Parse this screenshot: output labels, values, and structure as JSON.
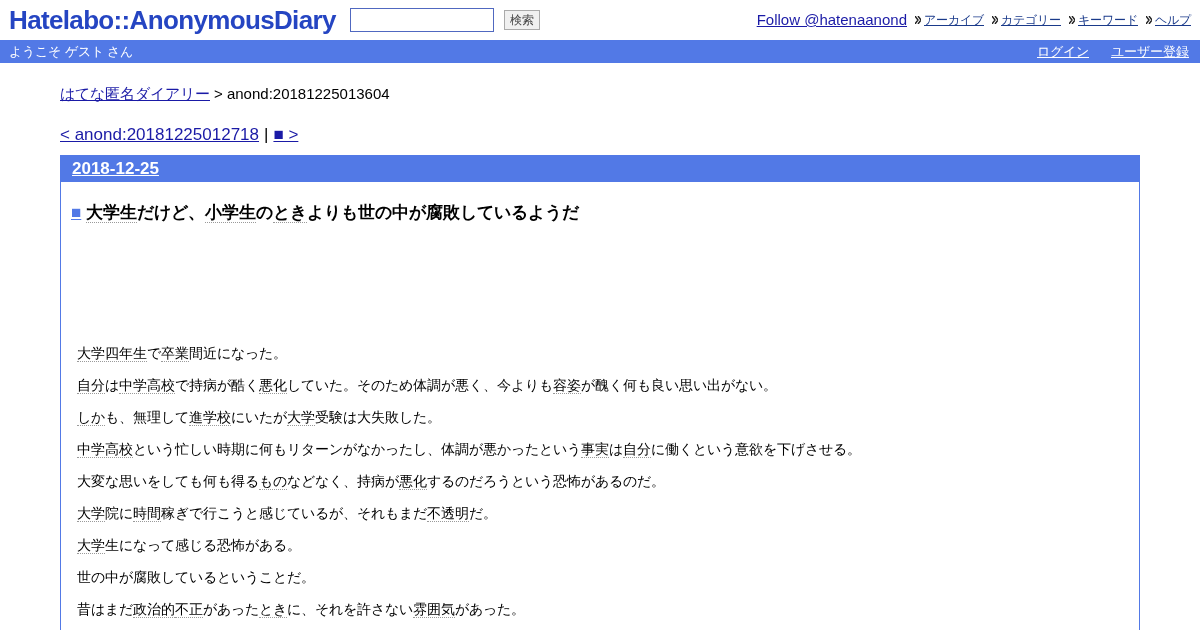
{
  "header": {
    "logo": "Hatelabo::AnonymousDiary",
    "search": {
      "button": "検索"
    },
    "follow": "Follow @hatenaanond",
    "nav": [
      "アーカイブ",
      "カテゴリー",
      "キーワード",
      "ヘルプ"
    ]
  },
  "bar": {
    "welcome": "ようこそ ゲスト さん",
    "links": [
      "ログイン",
      "ユーザー登録"
    ]
  },
  "breadcrumb": {
    "link": "はてな匿名ダイアリー",
    "current": "> anond:20181225013604"
  },
  "pager": {
    "prev": "< anond:20181225012718",
    "separator": "|",
    "next": "■ >"
  },
  "day": {
    "date": "2018-12-25",
    "title_mark": "■",
    "title": [
      {
        "text": "大学生",
        "keyword": true
      },
      {
        "text": "だけど、",
        "keyword": false
      },
      {
        "text": "小学生",
        "keyword": true
      },
      {
        "text": "の",
        "keyword": false
      },
      {
        "text": "とき",
        "keyword": true
      },
      {
        "text": "よりも世の中が腐敗しているようだ",
        "keyword": false
      }
    ],
    "paragraphs": [
      [
        {
          "text": "大学四年生",
          "keyword": true
        },
        {
          "text": "で",
          "keyword": false
        },
        {
          "text": "卒業",
          "keyword": true
        },
        {
          "text": "間近になった。",
          "keyword": false
        }
      ],
      [
        {
          "text": "自分",
          "keyword": true
        },
        {
          "text": "は",
          "keyword": false
        },
        {
          "text": "中学高校",
          "keyword": true
        },
        {
          "text": "で持病が酷く",
          "keyword": false
        },
        {
          "text": "悪化",
          "keyword": true
        },
        {
          "text": "していた。そのため体調が悪く、今よりも",
          "keyword": false
        },
        {
          "text": "容姿",
          "keyword": true
        },
        {
          "text": "が醜く何も良い思い出がない。",
          "keyword": false
        }
      ],
      [
        {
          "text": "しか",
          "keyword": true
        },
        {
          "text": "も、無理して",
          "keyword": false
        },
        {
          "text": "進学校",
          "keyword": true
        },
        {
          "text": "にいたが",
          "keyword": false
        },
        {
          "text": "大学",
          "keyword": true
        },
        {
          "text": "受験は大失敗した。",
          "keyword": false
        }
      ],
      [
        {
          "text": "中学高校",
          "keyword": true
        },
        {
          "text": "という忙しい時期に何もリターンがなかったし、体調が悪かったという",
          "keyword": false
        },
        {
          "text": "事実",
          "keyword": true
        },
        {
          "text": "は",
          "keyword": false
        },
        {
          "text": "自分",
          "keyword": true
        },
        {
          "text": "に働くという意欲を下げさせる。",
          "keyword": false
        }
      ],
      [
        {
          "text": "大変な思いをしても何も得る",
          "keyword": false
        },
        {
          "text": "もの",
          "keyword": true
        },
        {
          "text": "などなく、持病が",
          "keyword": false
        },
        {
          "text": "悪化",
          "keyword": true
        },
        {
          "text": "するのだろうという恐怖があるのだ。",
          "keyword": false
        }
      ],
      [
        {
          "text": "大学",
          "keyword": true
        },
        {
          "text": "院に",
          "keyword": false
        },
        {
          "text": "時間",
          "keyword": true
        },
        {
          "text": "稼ぎで行こうと感じているが、それもまだ",
          "keyword": false
        },
        {
          "text": "不透明",
          "keyword": true
        },
        {
          "text": "だ。",
          "keyword": false
        }
      ],
      [
        {
          "text": "大学",
          "keyword": true
        },
        {
          "text": "生になって感じる恐怖がある。",
          "keyword": false
        }
      ],
      [
        {
          "text": "世の中が腐敗しているということだ。",
          "keyword": false
        }
      ],
      [
        {
          "text": "昔はまだ",
          "keyword": false
        },
        {
          "text": "政治的",
          "keyword": true
        },
        {
          "text": "不正",
          "keyword": true
        },
        {
          "text": "があった",
          "keyword": false
        },
        {
          "text": "とき",
          "keyword": true
        },
        {
          "text": "に、それを許さない",
          "keyword": false
        },
        {
          "text": "雰囲気",
          "keyword": true
        },
        {
          "text": "があった。",
          "keyword": false
        }
      ]
    ]
  }
}
